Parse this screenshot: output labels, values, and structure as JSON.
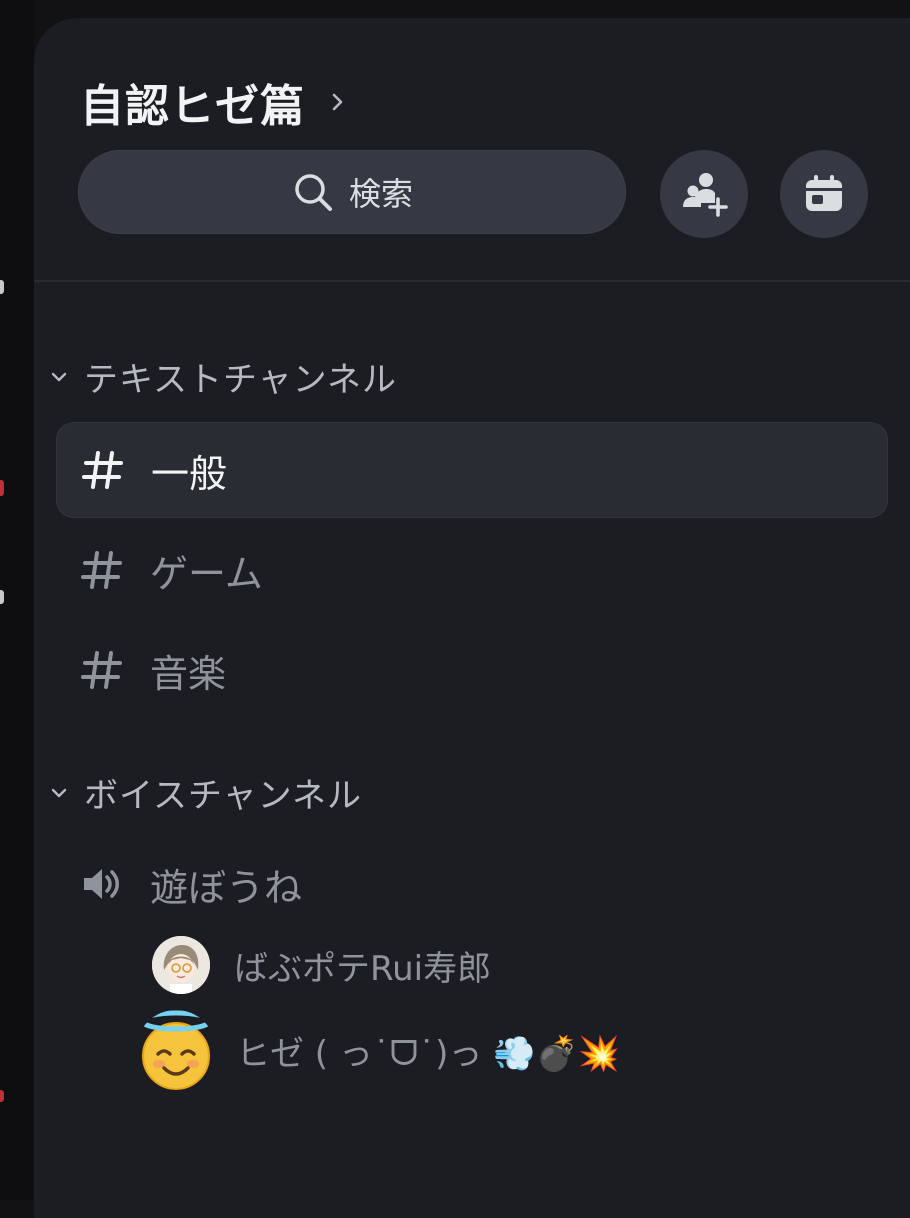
{
  "server": {
    "name": "自認ヒゼ篇"
  },
  "search": {
    "label": "検索"
  },
  "header_buttons": [
    {
      "icon": "add-member-icon"
    },
    {
      "icon": "calendar-icon"
    }
  ],
  "categories": {
    "text": {
      "label": "テキストチャンネル",
      "channels": [
        {
          "name": "一般",
          "selected": true
        },
        {
          "name": "ゲーム",
          "selected": false
        },
        {
          "name": "音楽",
          "selected": false
        }
      ]
    },
    "voice": {
      "label": "ボイスチャンネル",
      "channels": [
        {
          "name": "遊ぼうね",
          "users": [
            {
              "name": "ばぶポテRui寿郎",
              "avatar": "anime-character-avatar"
            },
            {
              "name": "ヒゼ ( っ˙ᗜ˙)っ 💨💣💥",
              "avatar": "smiling-halo-emoji-avatar"
            }
          ]
        }
      ]
    }
  },
  "colors": {
    "panel_bg": "#1c1d22",
    "selected_bg": "#2a2c33",
    "muted_text": "#8e939c",
    "bright_text": "#f2f3f5"
  }
}
